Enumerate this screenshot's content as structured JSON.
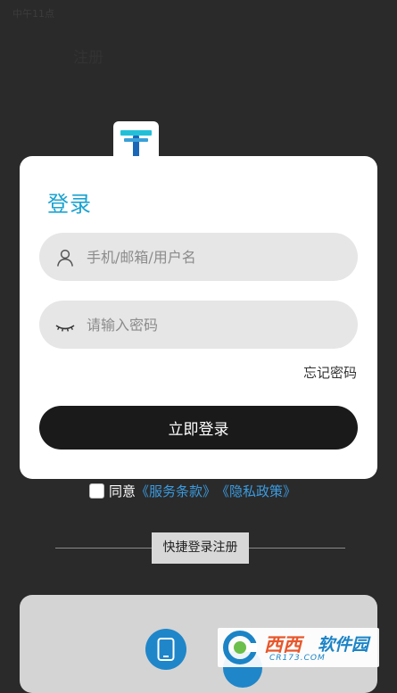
{
  "status_bar": {
    "time": "中午11点"
  },
  "top_nav": {
    "left_label": "注册",
    "middle_label": "",
    "right_label": ""
  },
  "brand": {
    "faded_text": ""
  },
  "login_card": {
    "title": "登录",
    "username": {
      "value": "",
      "placeholder": "手机/邮箱/用户名"
    },
    "password": {
      "value": "",
      "placeholder": "请输入密码"
    },
    "forgot_label": "忘记密码",
    "login_button_label": "立即登录"
  },
  "agreement": {
    "prefix": "同意",
    "terms_link": "《服务条款》",
    "privacy_link": "《隐私政策》",
    "checked": false
  },
  "quick_login": {
    "label": "快捷登录注册"
  },
  "watermark": {
    "name_a": "西西",
    "name_b": "软件园",
    "sub": "CR173.COM"
  },
  "colors": {
    "accent": "#1aa3d1",
    "link": "#3b9be0",
    "button_dark": "#1a1a1a",
    "field_bg": "#e7e6e7",
    "overlay_bg": "#2a2a2a"
  },
  "icons": {
    "logo": "t-logo-icon",
    "username": "user-icon",
    "password": "eye-closed-icon",
    "quick_phone": "phone-icon"
  }
}
